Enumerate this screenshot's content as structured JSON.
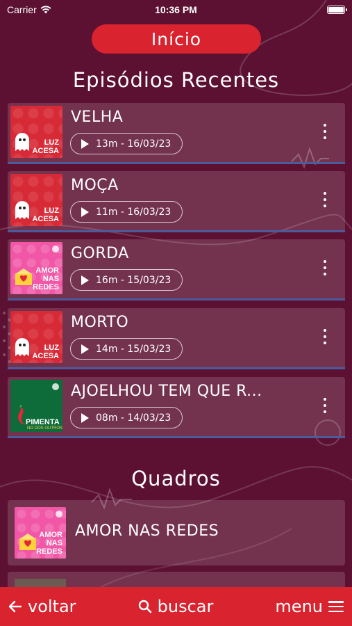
{
  "status_bar": {
    "carrier": "Carrier",
    "time": "10:36 PM"
  },
  "header": {
    "title": "Início"
  },
  "recent": {
    "title": "Episódios Recentes",
    "episodes": [
      {
        "title": "VELHA",
        "meta": "13m - 16/03/23",
        "thumb": {
          "kind": "luz",
          "line1": "LUZ",
          "line2": "ACESA"
        }
      },
      {
        "title": "MOÇA",
        "meta": "11m - 16/03/23",
        "thumb": {
          "kind": "luz",
          "line1": "LUZ",
          "line2": "ACESA"
        }
      },
      {
        "title": "GORDA",
        "meta": "16m - 15/03/23",
        "thumb": {
          "kind": "amor",
          "line1": "AMOR",
          "line2": "NAS",
          "line3": "REDES"
        }
      },
      {
        "title": "MORTO",
        "meta": "14m - 15/03/23",
        "thumb": {
          "kind": "luz",
          "line1": "LUZ",
          "line2": "ACESA"
        }
      },
      {
        "title": "AJOELHOU TEM QUE R...",
        "meta": "08m - 14/03/23",
        "thumb": {
          "kind": "pimenta",
          "line1": "PIMENTA",
          "line2": "NO DOS OUTROS"
        }
      }
    ]
  },
  "quadros": {
    "title": "Quadros",
    "items": [
      {
        "title": "AMOR NAS REDES",
        "thumb": {
          "kind": "amor",
          "line1": "AMOR",
          "line2": "NAS",
          "line3": "REDES"
        }
      }
    ]
  },
  "bottom_bar": {
    "back": "voltar",
    "search": "buscar",
    "menu": "menu"
  },
  "colors": {
    "background": "#5c1132",
    "accent": "#d9232f",
    "divider": "#4b5c9e"
  },
  "icons": [
    "wifi-icon",
    "battery-icon",
    "play-icon",
    "more-vertical-icon",
    "arrow-left-icon",
    "search-icon",
    "hamburger-icon"
  ]
}
